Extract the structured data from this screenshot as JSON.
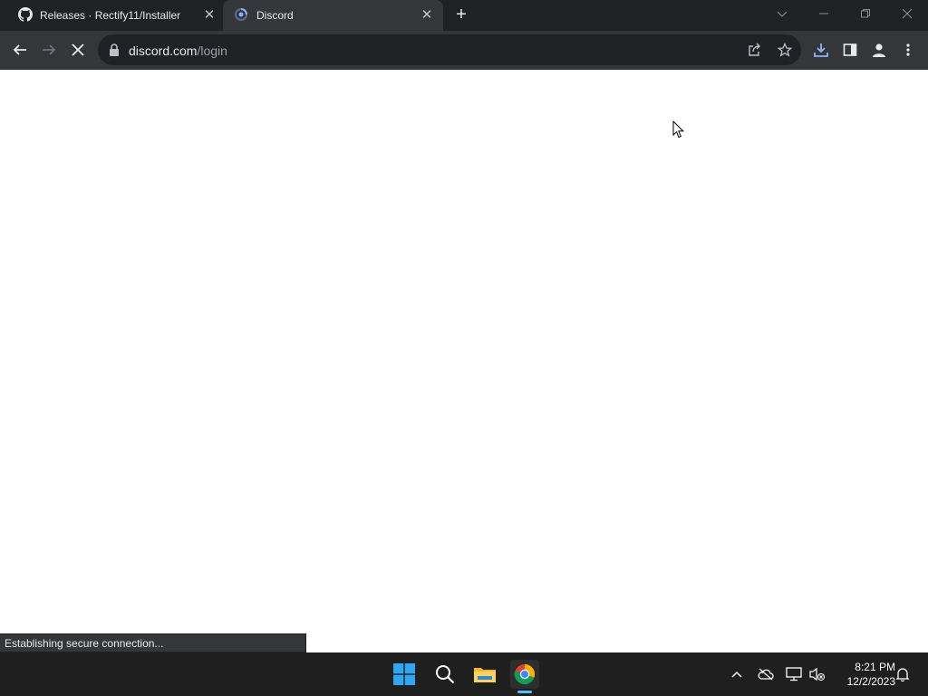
{
  "browser": {
    "tabs": [
      {
        "title": "Releases · Rectify11/Installer",
        "favicon": "github-icon",
        "active": false
      },
      {
        "title": "Discord",
        "favicon": "loading-spinner-icon",
        "active": true
      }
    ],
    "address_bar": {
      "domain": "discord.com",
      "path": "/login"
    },
    "status_bubble": "Establishing secure connection..."
  },
  "taskbar": {
    "time": "8:21 PM",
    "date": "12/2/2023"
  },
  "colors": {
    "tab_strip": "#202124",
    "toolbar": "#35363a",
    "taskbar": "#1f1f1f",
    "accent": "#4cc2ff"
  }
}
